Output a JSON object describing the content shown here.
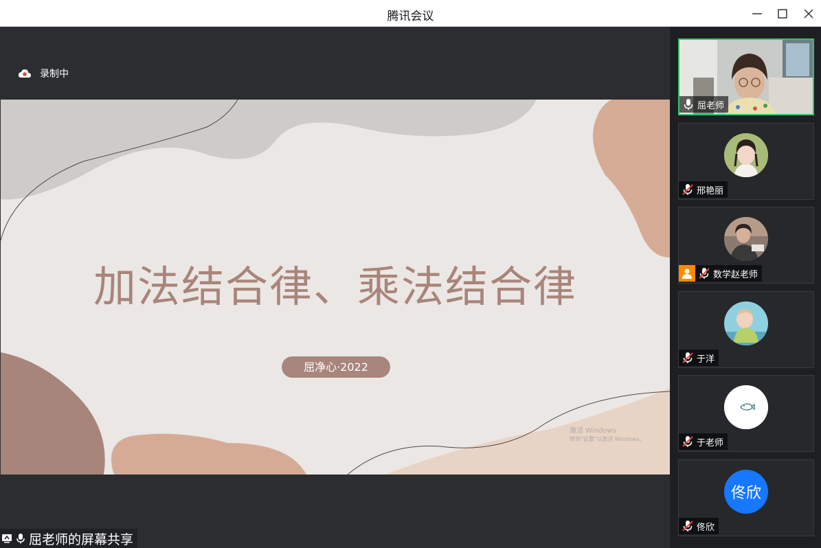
{
  "window": {
    "title": "腾讯会议"
  },
  "recording": {
    "label": "录制中"
  },
  "slide": {
    "title": "加法结合律、乘法结合律",
    "subtitle": "屈净心·2022",
    "watermark_line1": "激活 Windows",
    "watermark_line2": "转到\"设置\"以激活 Windows。"
  },
  "share_bar": {
    "label": "屈老师的屏幕共享"
  },
  "participants": [
    {
      "name": "屈老师",
      "mic": "on",
      "video": true,
      "active_speaker": true
    },
    {
      "name": "邢艳丽",
      "mic": "muted"
    },
    {
      "name": "数学赵老师",
      "mic": "muted",
      "badge": "host"
    },
    {
      "name": "于洋",
      "mic": "muted"
    },
    {
      "name": "于老师",
      "mic": "muted"
    },
    {
      "name": "佟欣",
      "mic": "muted",
      "avatar_text": "佟欣",
      "avatar_color": "#1677ff"
    }
  ],
  "colors": {
    "accent_green": "#32c566",
    "title_color": "#a8857a",
    "host_badge": "#ff8a00"
  }
}
